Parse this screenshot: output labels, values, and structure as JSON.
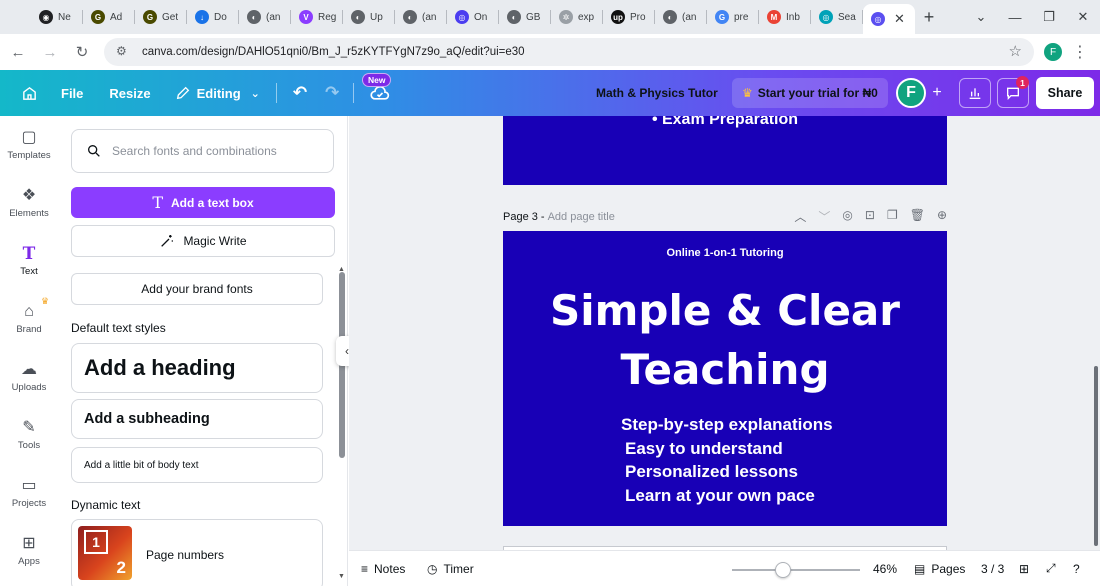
{
  "browser": {
    "tabs": [
      {
        "title": "Ne",
        "color": "#202124",
        "glyph": "◉"
      },
      {
        "title": "Ad",
        "color": "#4a4a00",
        "glyph": "G"
      },
      {
        "title": "Get",
        "color": "#4a4a00",
        "glyph": "G"
      },
      {
        "title": "Do",
        "color": "#1a73e8",
        "glyph": "↓"
      },
      {
        "title": "(an",
        "color": "#5f6368",
        "glyph": "◐"
      },
      {
        "title": "Reg",
        "color": "#8b3dff",
        "glyph": "V"
      },
      {
        "title": "Up",
        "color": "#5f6368",
        "glyph": "◐"
      },
      {
        "title": "(an",
        "color": "#5f6368",
        "glyph": "◐"
      },
      {
        "title": "On",
        "color": "#4b3df0",
        "glyph": "◎"
      },
      {
        "title": "GB",
        "color": "#5f6368",
        "glyph": "◐"
      },
      {
        "title": "exp",
        "color": "#9aa0a6",
        "glyph": "✲"
      },
      {
        "title": "Pro",
        "color": "#111111",
        "glyph": "up"
      },
      {
        "title": "(an",
        "color": "#5f6368",
        "glyph": "◐"
      },
      {
        "title": "pre",
        "color": "#4285f4",
        "glyph": "G"
      },
      {
        "title": "Inb",
        "color": "#ea4335",
        "glyph": "M"
      },
      {
        "title": "Sea",
        "color": "#00a2b8",
        "glyph": "◎"
      }
    ],
    "active_tab_glyph": "◎",
    "active_tab_color": "#5b4ff0",
    "close_glyph": "✕",
    "new_tab_glyph": "+",
    "url": "canva.com/design/DAHlO51qni0/Bm_J_r5zKYTFYgN7z9o_aQ/edit?ui=e30",
    "profile_initial": "F"
  },
  "header": {
    "file_label": "File",
    "resize_label": "Resize",
    "editing_label": "Editing",
    "new_badge": "New",
    "doc_title": "Math & Physics Tutor",
    "trial_label": "Start your trial for ₦0",
    "avatar_initial": "F",
    "notification_count": "1",
    "share_label": "Share"
  },
  "rail": {
    "items": [
      {
        "label": "Templates",
        "icon": "templates-icon",
        "glyph": "▢"
      },
      {
        "label": "Elements",
        "icon": "elements-icon",
        "glyph": "❖"
      },
      {
        "label": "Text",
        "icon": "text-icon",
        "glyph": "T"
      },
      {
        "label": "Brand",
        "icon": "brand-icon",
        "glyph": "⌂"
      },
      {
        "label": "Uploads",
        "icon": "uploads-icon",
        "glyph": "☁"
      },
      {
        "label": "Tools",
        "icon": "tools-icon",
        "glyph": "✎"
      },
      {
        "label": "Projects",
        "icon": "projects-icon",
        "glyph": "▭"
      },
      {
        "label": "Apps",
        "icon": "apps-icon",
        "glyph": "⊞"
      }
    ]
  },
  "panel": {
    "search_placeholder": "Search fonts and combinations",
    "add_text_box": "Add a text box",
    "magic_write": "Magic Write",
    "brand_fonts": "Add your brand fonts",
    "default_styles_title": "Default text styles",
    "heading": "Add a heading",
    "subheading": "Add a subheading",
    "body": "Add a little bit of body text",
    "dynamic_title": "Dynamic text",
    "page_numbers": "Page numbers",
    "thumb_one": "1",
    "thumb_two": "2"
  },
  "canvas": {
    "page2_fragment": "• Exam Preparation",
    "page_label": "Page 3 -",
    "page_title_placeholder": "Add page title",
    "slide": {
      "kicker": "Online 1-on-1 Tutoring",
      "title_line1": "Simple & Clear",
      "title_line2": "Teaching",
      "bullets": [
        "Step-by-step explanations",
        "Easy to understand",
        "Personalized lessons",
        "Learn at your own pace"
      ],
      "background": "#1800b6"
    }
  },
  "footer": {
    "notes_label": "Notes",
    "timer_label": "Timer",
    "zoom_percent": 46,
    "zoom_label": "46%",
    "pages_label": "Pages",
    "page_count": "3 / 3"
  },
  "colors": {
    "accent_purple": "#8b3dff",
    "slide_blue": "#1800b6"
  }
}
